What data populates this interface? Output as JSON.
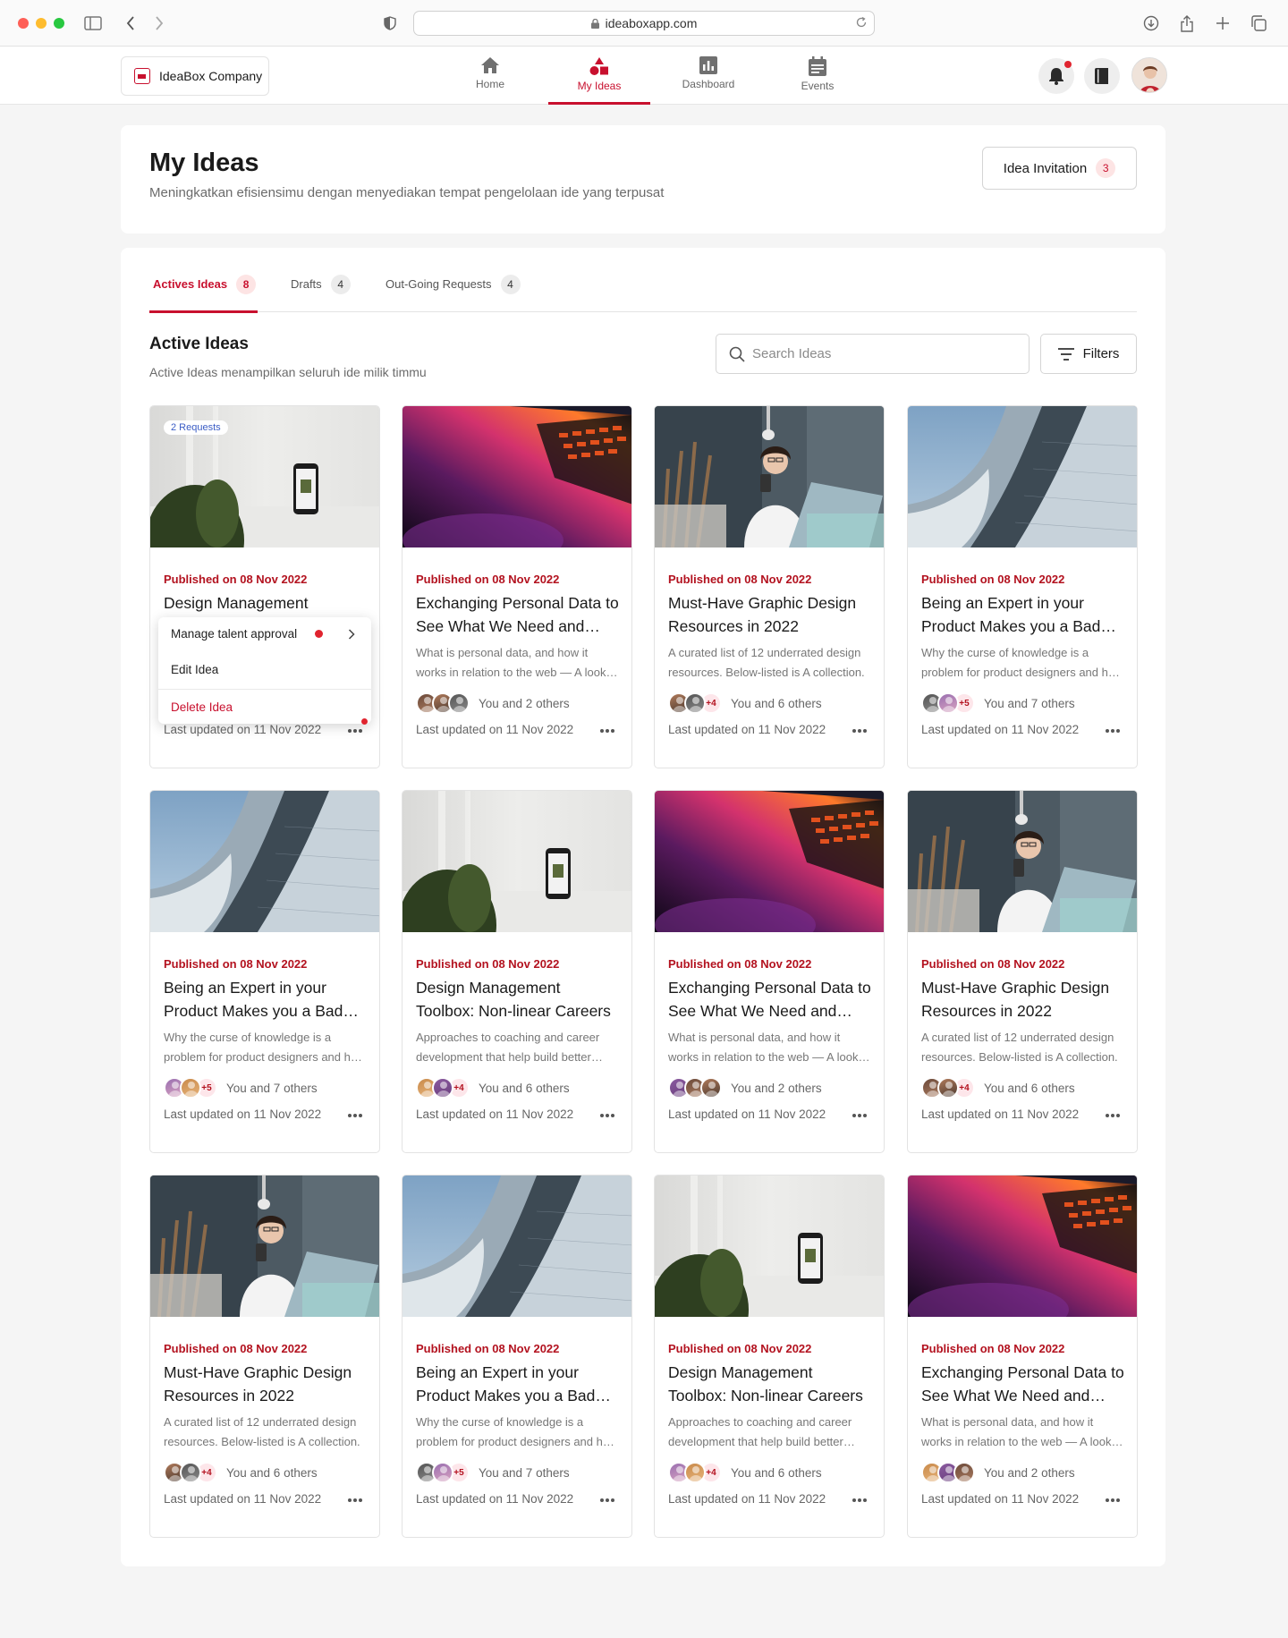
{
  "browser": {
    "url": "ideaboxapp.com"
  },
  "company": {
    "name": "IdeaBox Company"
  },
  "nav": {
    "tabs": [
      {
        "label": "Home",
        "icon": "home-icon"
      },
      {
        "label": "My Ideas",
        "icon": "shapes-icon",
        "active": true
      },
      {
        "label": "Dashboard",
        "icon": "chart-icon"
      },
      {
        "label": "Events",
        "icon": "calendar-icon"
      }
    ]
  },
  "header": {
    "title": "My Ideas",
    "subtitle": "Meningkatkan efisiensimu dengan menyediakan tempat pengelolaan ide yang terpusat",
    "invitation_label": "Idea Invitation",
    "invitation_count": "3"
  },
  "tabs": [
    {
      "label": "Actives Ideas",
      "count": "8"
    },
    {
      "label": "Drafts",
      "count": "4"
    },
    {
      "label": "Out-Going Requests",
      "count": "4"
    }
  ],
  "section": {
    "title": "Active Ideas",
    "subtitle": "Active Ideas menampilkan seluruh ide milik timmu",
    "search_placeholder": "Search Ideas",
    "filters_label": "Filters"
  },
  "menu": {
    "items": [
      "Manage talent approval",
      "Edit Idea",
      "Delete Idea"
    ]
  },
  "cards": [
    {
      "image": "phone",
      "badge": "2 Requests",
      "published": "Published on 08 Nov 2022",
      "title": "Design Management",
      "description": "",
      "avatars": 0,
      "more": "",
      "others": "",
      "updated": "Last updated on 11 Nov 2022"
    },
    {
      "image": "laptop",
      "published": "Published on 08 Nov 2022",
      "title": "Exchanging Personal Data to See What We Need and Want",
      "description": "What is personal data, and how it works in relation to the web — A look at data.",
      "avatars": 3,
      "more": "",
      "others": "You and 2 others",
      "updated": "Last updated on 11 Nov 2022"
    },
    {
      "image": "woman",
      "published": "Published on 08 Nov 2022",
      "title": "Must-Have Graphic Design Resources in 2022",
      "description": "A curated list of 12 underrated design resources. Below-listed is A collection.",
      "avatars": 2,
      "more": "+4",
      "others": "You and 6 others",
      "updated": "Last updated on 11 Nov 2022"
    },
    {
      "image": "building",
      "published": "Published on 08 Nov 2022",
      "title": "Being an Expert in your Product Makes you a Bad Designer",
      "description": "Why the curse of knowledge is a problem for product designers and how to fix it.",
      "avatars": 2,
      "more": "+5",
      "others": "You and 7 others",
      "updated": "Last updated on 11 Nov 2022"
    },
    {
      "image": "building",
      "published": "Published on 08 Nov 2022",
      "title": "Being an Expert in your Product Makes you a Bad Designer",
      "description": "Why the curse of knowledge is a problem for product designers and how to fix it.",
      "avatars": 2,
      "more": "+5",
      "others": "You and 7 others",
      "updated": "Last updated on 11 Nov 2022"
    },
    {
      "image": "phone",
      "published": "Published on 08 Nov 2022",
      "title": "Design Management Toolbox: Non-linear Careers",
      "description": "Approaches to coaching and career development that help build better teams.",
      "avatars": 2,
      "more": "+4",
      "others": "You and 6 others",
      "updated": "Last updated on 11 Nov 2022"
    },
    {
      "image": "laptop",
      "published": "Published on 08 Nov 2022",
      "title": "Exchanging Personal Data to See What We Need and Want",
      "description": "What is personal data, and how it works in relation to the web — A look at data.",
      "avatars": 3,
      "more": "",
      "others": "You and 2 others",
      "updated": "Last updated on 11 Nov 2022"
    },
    {
      "image": "woman",
      "published": "Published on 08 Nov 2022",
      "title": "Must-Have Graphic Design Resources in 2022",
      "description": "A curated list of 12 underrated design resources. Below-listed is A collection.",
      "avatars": 2,
      "more": "+4",
      "others": "You and 6 others",
      "updated": "Last updated on 11 Nov 2022"
    },
    {
      "image": "woman",
      "published": "Published on 08 Nov 2022",
      "title": "Must-Have Graphic Design Resources in 2022",
      "description": "A curated list of 12 underrated design resources. Below-listed is A collection.",
      "avatars": 2,
      "more": "+4",
      "others": "You and 6 others",
      "updated": "Last updated on 11 Nov 2022"
    },
    {
      "image": "building",
      "published": "Published on 08 Nov 2022",
      "title": "Being an Expert in your Product Makes you a Bad Designer",
      "description": "Why the curse of knowledge is a problem for product designers and how to fix it.",
      "avatars": 2,
      "more": "+5",
      "others": "You and 7 others",
      "updated": "Last updated on 11 Nov 2022"
    },
    {
      "image": "phone",
      "published": "Published on 08 Nov 2022",
      "title": "Design Management Toolbox: Non-linear Careers",
      "description": "Approaches to coaching and career development that help build better teams.",
      "avatars": 2,
      "more": "+4",
      "others": "You and 6 others",
      "updated": "Last updated on 11 Nov 2022"
    },
    {
      "image": "laptop",
      "published": "Published on 08 Nov 2022",
      "title": "Exchanging Personal Data to See What We Need and Want",
      "description": "What is personal data, and how it works in relation to the web — A look at data.",
      "avatars": 3,
      "more": "",
      "others": "You and 2 others",
      "updated": "Last updated on 11 Nov 2022"
    }
  ],
  "colors": {
    "accent": "#c8102e",
    "published": "#b3121f",
    "request_badge": "#3a5cc5"
  }
}
